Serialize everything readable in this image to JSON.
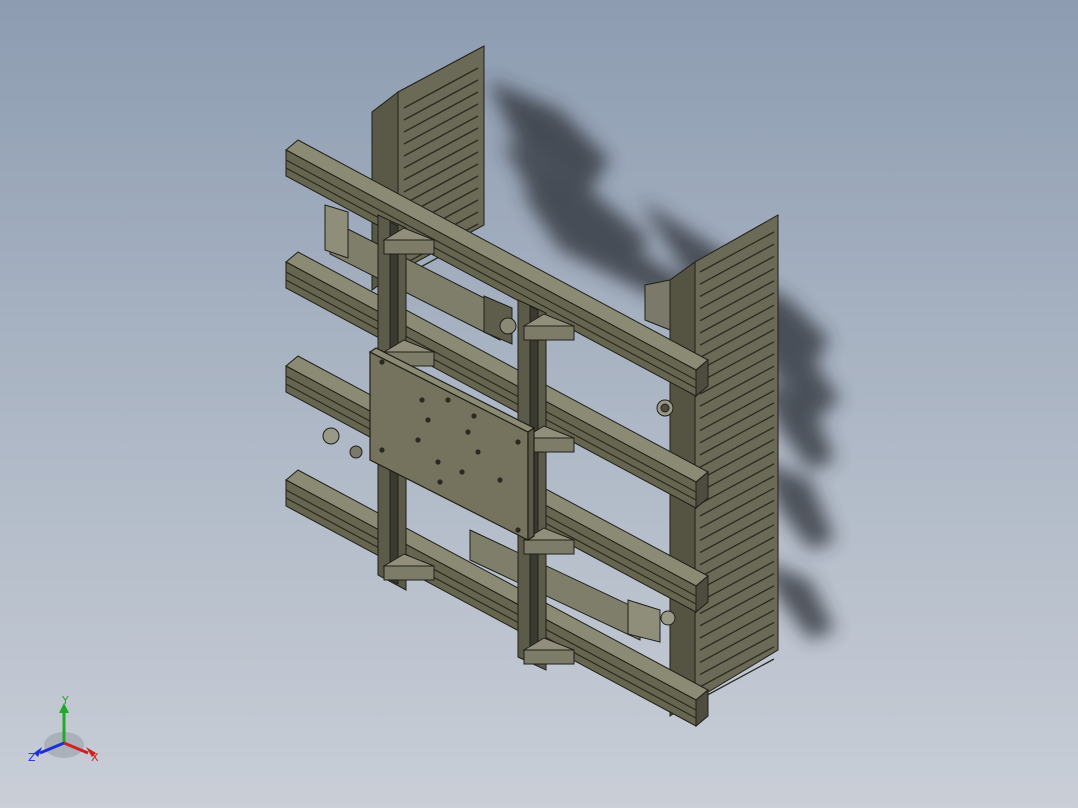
{
  "viewport": {
    "background_top": "#8d9cb1",
    "background_bottom": "#c9ced7",
    "model_color": "#6e6c58",
    "model_edge_color": "#1f1f1a",
    "shadow_color": "#2b2f36"
  },
  "triad": {
    "icon": "view-orientation-triad-icon",
    "x_label": "X",
    "y_label": "Y",
    "z_label": "Z",
    "x_color": "#d02020",
    "y_color": "#1faa2a",
    "z_color": "#1d2fd6"
  }
}
